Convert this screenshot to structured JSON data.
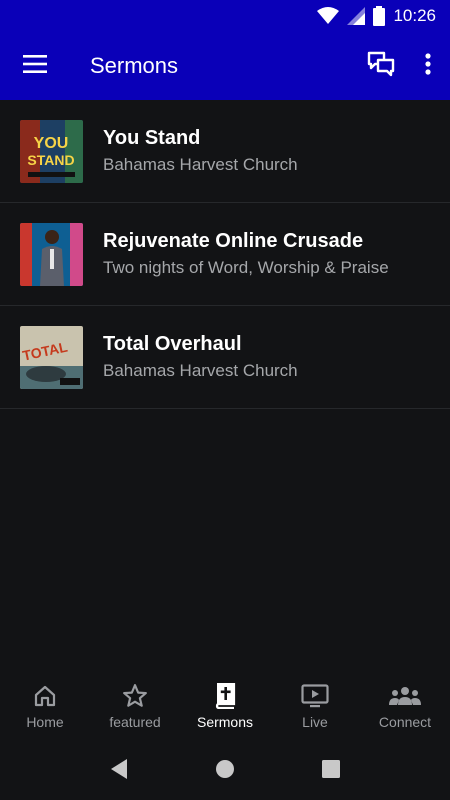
{
  "status_bar": {
    "time": "10:26"
  },
  "app_bar": {
    "title": "Sermons",
    "menu_icon": "hamburger-menu-icon",
    "chat_icon": "chat-bubbles-icon",
    "more_icon": "more-vert-icon"
  },
  "sermons": [
    {
      "title": "You Stand",
      "subtitle": "Bahamas Harvest Church"
    },
    {
      "title": "Rejuvenate Online Crusade",
      "subtitle": "Two nights of Word, Worship & Praise"
    },
    {
      "title": "Total Overhaul",
      "subtitle": "Bahamas Harvest Church"
    }
  ],
  "bottom_nav": [
    {
      "label": "Home",
      "icon": "home-icon",
      "active": false
    },
    {
      "label": "featured",
      "icon": "star-icon",
      "active": false
    },
    {
      "label": "Sermons",
      "icon": "bible-icon",
      "active": true
    },
    {
      "label": "Live",
      "icon": "tv-play-icon",
      "active": false
    },
    {
      "label": "Connect",
      "icon": "people-group-icon",
      "active": false
    }
  ],
  "colors": {
    "app_bar": "#0a00b8",
    "background": "#121315",
    "inactive_nav": "#9a9ca0",
    "subtitle": "#a5a7aa"
  }
}
